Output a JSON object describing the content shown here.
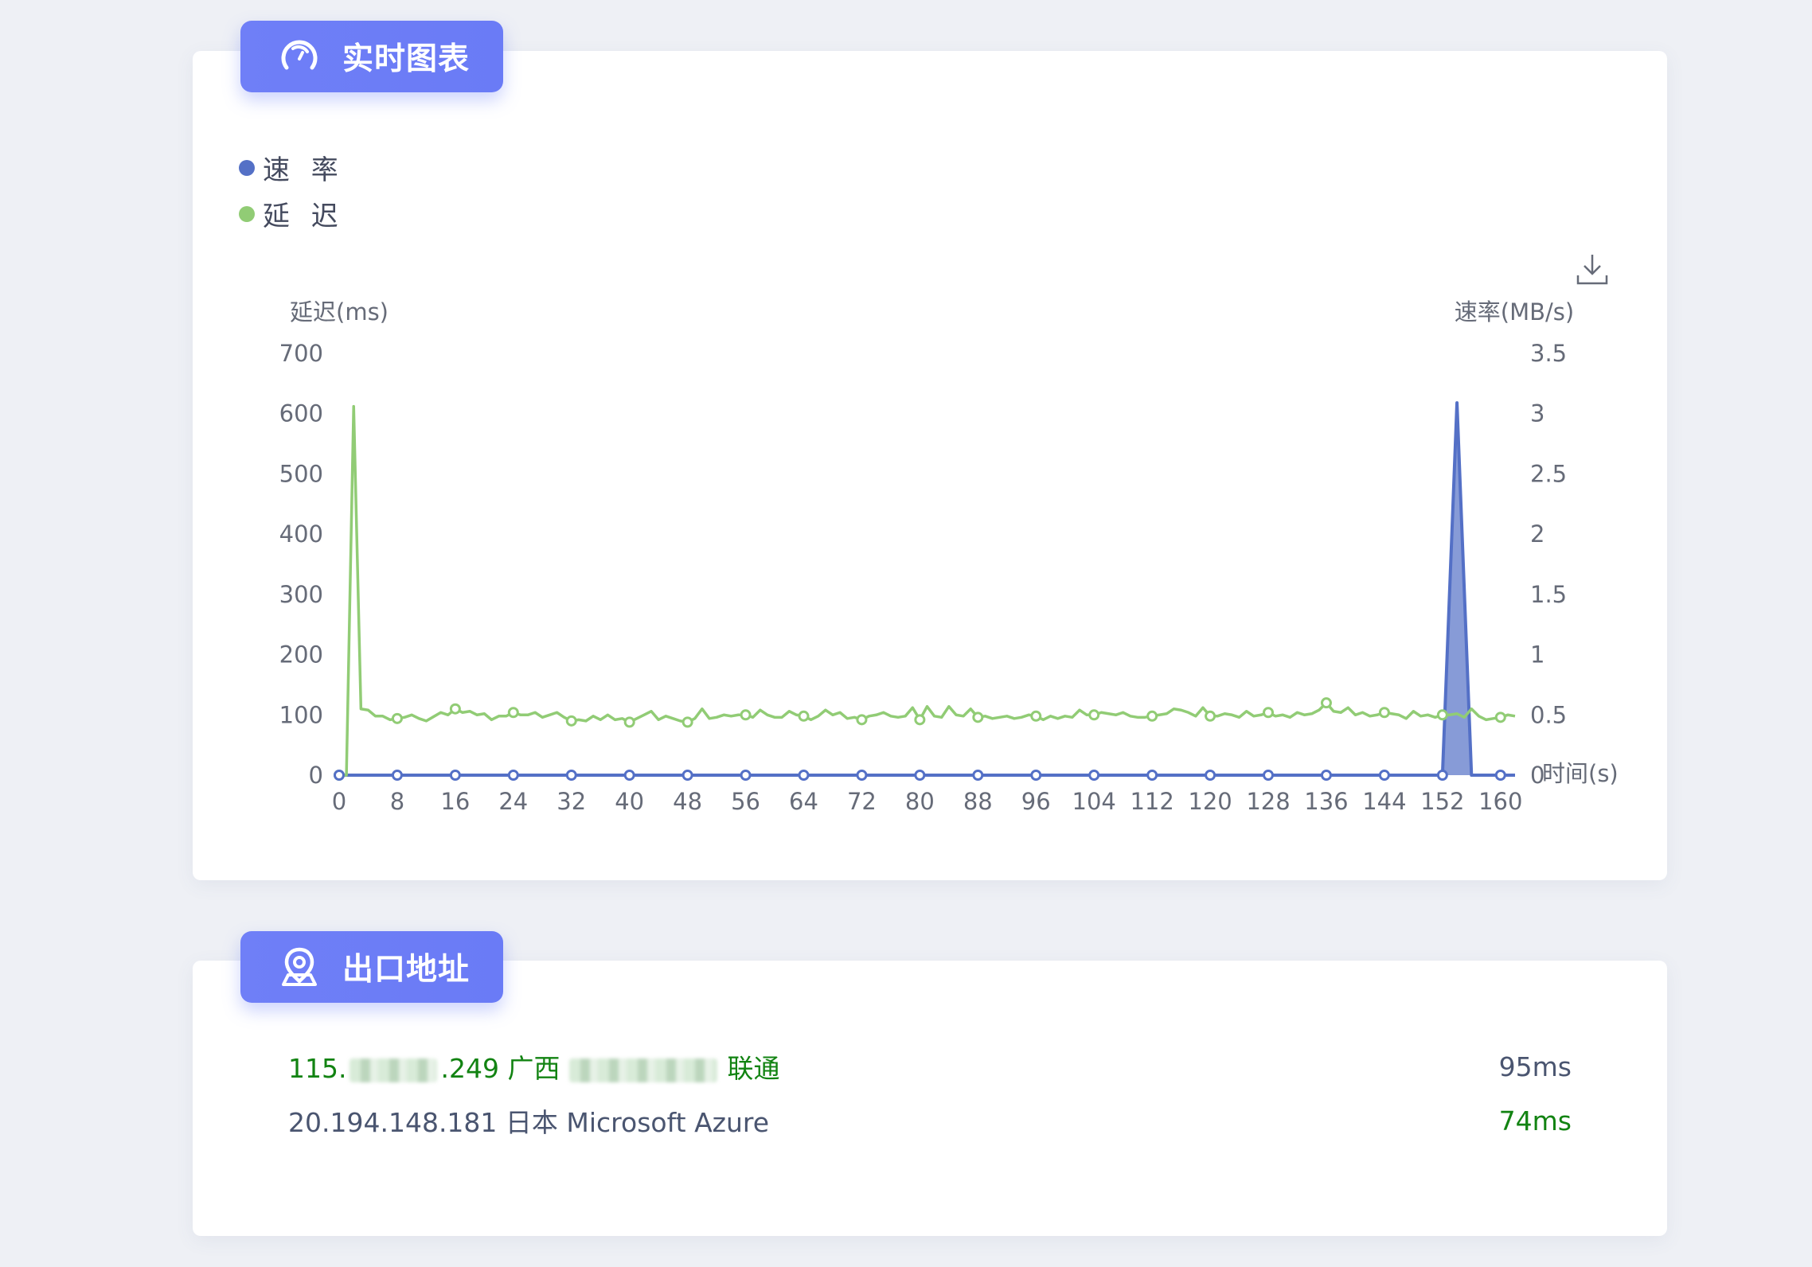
{
  "chart_section": {
    "title": "实时图表",
    "header_icon": "speedometer-icon",
    "download_icon": "download-icon"
  },
  "chart_data": {
    "type": "line",
    "legend": [
      {
        "name": "速 率",
        "color": "#5470c6"
      },
      {
        "name": "延 迟",
        "color": "#91cc75"
      }
    ],
    "y_left_label": "延迟(ms)",
    "y_right_label": "速率(MB/s)",
    "x_label": "时间(s)",
    "y_left_range": [
      0,
      700
    ],
    "y_right_range": [
      0,
      3.5
    ],
    "x_range": [
      0,
      162
    ],
    "y_left_ticks": [
      "0",
      "100",
      "200",
      "300",
      "400",
      "500",
      "600",
      "700"
    ],
    "y_right_ticks": [
      "0",
      "0.5",
      "1",
      "1.5",
      "2",
      "2.5",
      "3",
      "3.5"
    ],
    "x_ticks": [
      "0",
      "8",
      "16",
      "24",
      "32",
      "40",
      "48",
      "56",
      "64",
      "72",
      "80",
      "88",
      "96",
      "104",
      "112",
      "120",
      "128",
      "136",
      "144",
      "152",
      "160"
    ],
    "series": [
      {
        "name": "速率",
        "axis": "right",
        "color": "#5470c6",
        "area": true,
        "points": [
          [
            0,
            0
          ],
          [
            152,
            0
          ],
          [
            154,
            3.09
          ],
          [
            156,
            0
          ],
          [
            162,
            0
          ]
        ],
        "markers": [
          0,
          8,
          16,
          24,
          32,
          40,
          48,
          56,
          64,
          72,
          80,
          88,
          96,
          104,
          112,
          120,
          128,
          136,
          144,
          152,
          160
        ]
      },
      {
        "name": "延迟",
        "axis": "left",
        "color": "#91cc75",
        "points": [
          [
            0,
            0
          ],
          [
            1,
            0
          ],
          [
            2,
            612
          ],
          [
            3,
            110
          ],
          [
            4,
            108
          ],
          [
            5,
            98
          ],
          [
            6,
            98
          ],
          [
            7,
            92
          ],
          [
            8,
            94
          ],
          [
            9,
            96
          ],
          [
            10,
            100
          ],
          [
            11,
            94
          ],
          [
            12,
            90
          ],
          [
            13,
            97
          ],
          [
            14,
            104
          ],
          [
            15,
            100
          ],
          [
            16,
            110
          ],
          [
            17,
            104
          ],
          [
            18,
            106
          ],
          [
            19,
            100
          ],
          [
            20,
            102
          ],
          [
            21,
            92
          ],
          [
            22,
            98
          ],
          [
            23,
            98
          ],
          [
            24,
            104
          ],
          [
            25,
            100
          ],
          [
            26,
            100
          ],
          [
            27,
            104
          ],
          [
            28,
            96
          ],
          [
            29,
            100
          ],
          [
            30,
            104
          ],
          [
            31,
            96
          ],
          [
            32,
            90
          ],
          [
            33,
            92
          ],
          [
            34,
            90
          ],
          [
            35,
            98
          ],
          [
            36,
            92
          ],
          [
            37,
            100
          ],
          [
            38,
            92
          ],
          [
            39,
            94
          ],
          [
            40,
            88
          ],
          [
            41,
            94
          ],
          [
            42,
            100
          ],
          [
            43,
            106
          ],
          [
            44,
            92
          ],
          [
            45,
            98
          ],
          [
            46,
            94
          ],
          [
            47,
            90
          ],
          [
            48,
            88
          ],
          [
            49,
            94
          ],
          [
            50,
            110
          ],
          [
            51,
            94
          ],
          [
            52,
            96
          ],
          [
            53,
            100
          ],
          [
            54,
            98
          ],
          [
            55,
            100
          ],
          [
            56,
            100
          ],
          [
            57,
            96
          ],
          [
            58,
            108
          ],
          [
            59,
            100
          ],
          [
            60,
            96
          ],
          [
            61,
            96
          ],
          [
            62,
            106
          ],
          [
            63,
            100
          ],
          [
            64,
            98
          ],
          [
            65,
            92
          ],
          [
            66,
            98
          ],
          [
            67,
            108
          ],
          [
            68,
            100
          ],
          [
            69,
            104
          ],
          [
            70,
            94
          ],
          [
            71,
            96
          ],
          [
            72,
            92
          ],
          [
            73,
            98
          ],
          [
            74,
            100
          ],
          [
            75,
            104
          ],
          [
            76,
            98
          ],
          [
            77,
            96
          ],
          [
            78,
            98
          ],
          [
            79,
            112
          ],
          [
            80,
            92
          ],
          [
            81,
            114
          ],
          [
            82,
            98
          ],
          [
            83,
            96
          ],
          [
            84,
            114
          ],
          [
            85,
            100
          ],
          [
            86,
            98
          ],
          [
            87,
            110
          ],
          [
            88,
            96
          ],
          [
            89,
            98
          ],
          [
            90,
            94
          ],
          [
            91,
            96
          ],
          [
            92,
            98
          ],
          [
            93,
            94
          ],
          [
            94,
            96
          ],
          [
            95,
            100
          ],
          [
            96,
            98
          ],
          [
            97,
            92
          ],
          [
            98,
            98
          ],
          [
            99,
            94
          ],
          [
            100,
            98
          ],
          [
            101,
            96
          ],
          [
            102,
            108
          ],
          [
            103,
            100
          ],
          [
            104,
            100
          ],
          [
            105,
            104
          ],
          [
            106,
            102
          ],
          [
            107,
            100
          ],
          [
            108,
            104
          ],
          [
            109,
            98
          ],
          [
            110,
            96
          ],
          [
            111,
            96
          ],
          [
            112,
            98
          ],
          [
            113,
            100
          ],
          [
            114,
            102
          ],
          [
            115,
            110
          ],
          [
            116,
            108
          ],
          [
            117,
            104
          ],
          [
            118,
            98
          ],
          [
            119,
            112
          ],
          [
            120,
            98
          ],
          [
            121,
            98
          ],
          [
            122,
            102
          ],
          [
            123,
            100
          ],
          [
            124,
            96
          ],
          [
            125,
            106
          ],
          [
            126,
            98
          ],
          [
            127,
            100
          ],
          [
            128,
            104
          ],
          [
            129,
            98
          ],
          [
            130,
            100
          ],
          [
            131,
            96
          ],
          [
            132,
            104
          ],
          [
            133,
            100
          ],
          [
            134,
            102
          ],
          [
            135,
            108
          ],
          [
            136,
            120
          ],
          [
            137,
            106
          ],
          [
            138,
            104
          ],
          [
            139,
            112
          ],
          [
            140,
            100
          ],
          [
            141,
            104
          ],
          [
            142,
            98
          ],
          [
            143,
            100
          ],
          [
            144,
            104
          ],
          [
            145,
            102
          ],
          [
            146,
            100
          ],
          [
            147,
            94
          ],
          [
            148,
            106
          ],
          [
            149,
            98
          ],
          [
            150,
            100
          ],
          [
            151,
            96
          ],
          [
            152,
            100
          ],
          [
            153,
            100
          ],
          [
            154,
            102
          ],
          [
            155,
            96
          ],
          [
            156,
            110
          ],
          [
            157,
            98
          ],
          [
            158,
            92
          ],
          [
            159,
            94
          ],
          [
            160,
            96
          ],
          [
            161,
            100
          ],
          [
            162,
            98
          ]
        ],
        "markers": [
          0,
          8,
          16,
          24,
          32,
          40,
          48,
          56,
          64,
          72,
          80,
          88,
          96,
          104,
          112,
          120,
          128,
          136,
          144,
          152,
          160
        ]
      }
    ]
  },
  "exit_section": {
    "title": "出口地址",
    "header_icon": "location-pin-icon",
    "rows": [
      {
        "prefix": "115.",
        "suffix": ".249 广西",
        "tail": "联通",
        "latency": "95ms",
        "address_color": "#128312",
        "latency_color": "#4a5570"
      },
      {
        "address": "20.194.148.181 日本 Microsoft Azure",
        "latency": "74ms",
        "address_color": "#4a5570",
        "latency_color": "#128312"
      }
    ]
  }
}
